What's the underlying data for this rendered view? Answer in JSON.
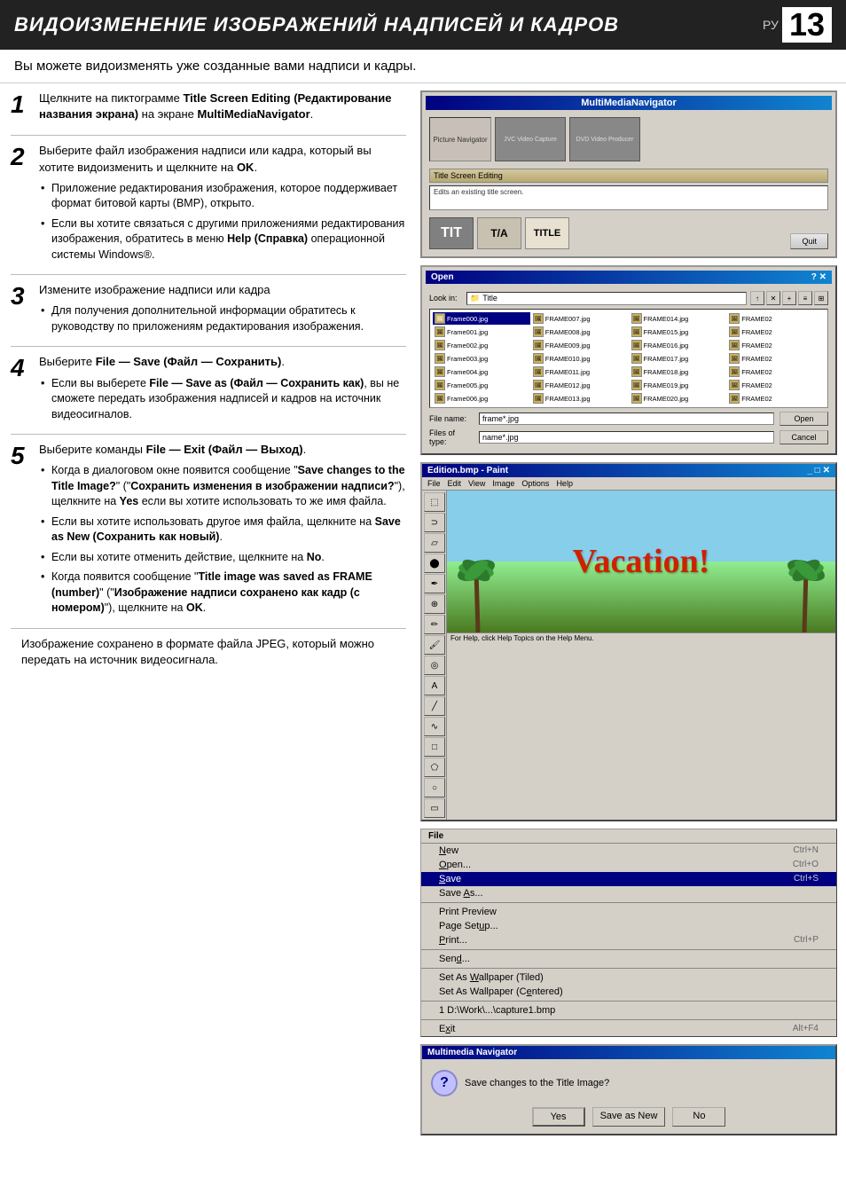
{
  "header": {
    "title": "ВИДОИЗМЕНЕНИЕ ИЗОБРАЖЕНИЙ НАДПИСЕЙ И КАДРОВ",
    "page_label": "РУ",
    "page_number": "13"
  },
  "subtitle": "Вы можете видоизменять уже созданные вами надписи и кадры.",
  "steps": [
    {
      "number": "1",
      "main_text": "Щелкните на пиктограмме Title Screen Editing (Редактирование названия экрана) на экране MultiMediaNavigator.",
      "bullets": []
    },
    {
      "number": "2",
      "main_text": "Выберите файл изображения надписи или кадра, который вы хотите видоизменить и щелкните на OK.",
      "bullets": [
        "Приложение редактирования изображения, которое поддерживает формат битовой карты (BMP), открыто.",
        "Если вы хотите связаться с другими приложениями редактирования изображения, обратитесь в меню Help (Справка) операционной системы Windows®."
      ]
    },
    {
      "number": "3",
      "main_text": "Измените изображение надписи или кадра",
      "bullets": [
        "Для получения дополнительной информации обратитесь к руководству по приложениям редактирования изображения."
      ]
    },
    {
      "number": "4",
      "main_text": "Выберите File — Save (Файл — Сохранить).",
      "bullets": [
        "Если вы выберете File — Save as (Файл — Сохранить как), вы не сможете передать изображения надписей и кадров на источник видеосигналов."
      ]
    },
    {
      "number": "5",
      "main_text": "Выберите команды File — Exit (Файл — Выход).",
      "bullets": [
        "Когда в диалоговом окне появится сообщение \"Save changes to the Title Image?\" (\"Сохранить изменения в изображении надписи?\"), щелкните на Yes если вы хотите использовать то же имя файла.",
        "Если вы хотите использовать другое имя файла, щелкните на Save as New (Сохранить как новый).",
        "Если вы хотите отменить действие, щелкните на No.",
        "Когда появится сообщение \"Title image was saved as FRAME (number)\" (\"Изображение надписи сохранено как кадр (с номером)\"), щелкните на OK."
      ]
    }
  ],
  "footer_text": "Изображение сохранено в формате файла JPEG, который можно передать на источник видеосигнала.",
  "screenshots": {
    "mmn": {
      "titlebar": "MultiMediaNavigator",
      "picture_navigator": "Picture Navigator",
      "button1": "Title Screen Editing",
      "button_desc": "Edits an existing title screen.",
      "quit": "Quit"
    },
    "open_dialog": {
      "title": "Open",
      "lookin_label": "Look in:",
      "lookin_value": "Title",
      "filename_label": "File name:",
      "filename_value": "frame*.jpg",
      "filetype_label": "Files of type:",
      "filetype_value": "name*.jpg",
      "open_btn": "Open",
      "cancel_btn": "Cancel",
      "files": [
        "Frame000.jpg",
        "Frame001.jpg",
        "Frame002.jpg",
        "Frame003.jpg",
        "Frame004.jpg",
        "Frame005.jpg",
        "Frame006.jpg",
        "FRAME007.jpg",
        "FRAME008.jpg",
        "FRAME009.jpg",
        "FRAME010.jpg",
        "FRAME011.jpg",
        "FRAME012.jpg",
        "FRAME013.jpg",
        "FRAME014.jpg",
        "FRAME015.jpg",
        "FRAME016.jpg",
        "FRAME017.jpg",
        "FRAME018.jpg",
        "FRAME019.jpg",
        "FRAME020.jpg",
        "FRAME02",
        "FRAME02",
        "FRAME02",
        "FRAME02",
        "FRAME02",
        "FRAME02",
        "FRAME02"
      ]
    },
    "paint": {
      "titlebar": "Edition.bmp - Paint",
      "menu_items": [
        "File",
        "Edit",
        "View",
        "Image",
        "Options",
        "Help"
      ],
      "canvas_text": "Vacation!",
      "tools": [
        "✎",
        "✂",
        "⬜",
        "⭕",
        "🖌",
        "🪣",
        "🖊",
        "🔍"
      ]
    },
    "file_menu": {
      "title": "File",
      "items": [
        {
          "label": "New",
          "shortcut": "Ctrl+N"
        },
        {
          "label": "Open...",
          "shortcut": "Ctrl+O"
        },
        {
          "label": "Save",
          "shortcut": "Ctrl+S",
          "highlighted": true
        },
        {
          "label": "Save As...",
          "shortcut": ""
        },
        {
          "label": "Print Preview",
          "shortcut": ""
        },
        {
          "label": "Page Setup...",
          "shortcut": ""
        },
        {
          "label": "Print...",
          "shortcut": "Ctrl+P"
        },
        {
          "label": "Send...",
          "shortcut": ""
        },
        {
          "label": "Set As Wallpaper (Tiled)",
          "shortcut": ""
        },
        {
          "label": "Set As Wallpaper (Centered)",
          "shortcut": ""
        },
        {
          "label": "1 D:\\Work\\...\\capture1.bmp",
          "shortcut": ""
        },
        {
          "label": "Exit",
          "shortcut": "Alt+F4"
        }
      ]
    },
    "mmn_dialog": {
      "titlebar": "Multimedia Navigator",
      "message": "Save changes to the Title Image?",
      "yes_btn": "Yes",
      "save_new_btn": "Save as New",
      "no_btn": "No"
    }
  }
}
